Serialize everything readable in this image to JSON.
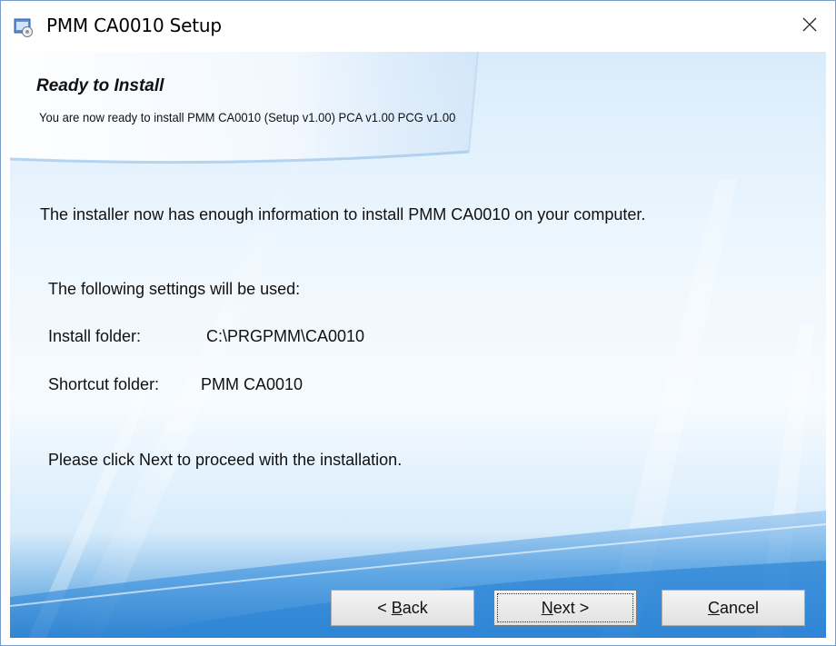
{
  "window": {
    "title": "PMM CA0010 Setup"
  },
  "header": {
    "title": "Ready to Install",
    "subtitle": "You are now ready to install PMM CA0010 (Setup v1.00) PCA v1.00 PCG v1.00"
  },
  "body": {
    "intro": "The installer now has enough information to install PMM CA0010 on your computer.",
    "settings_heading": "The following settings will be used:",
    "install_folder_label": "Install folder:",
    "install_folder_value": "C:\\PRGPMM\\CA0010",
    "shortcut_folder_label": "Shortcut folder:",
    "shortcut_folder_value": "PMM CA0010",
    "instruction": "Please click Next to proceed with the installation."
  },
  "buttons": {
    "back_prefix": "< ",
    "back_accel": "B",
    "back_rest": "ack",
    "next_accel": "N",
    "next_rest": "ext >",
    "cancel_accel": "C",
    "cancel_rest": "ancel"
  },
  "icons": {
    "app": "installer-app-icon",
    "close": "close-icon"
  },
  "colors": {
    "accent_blue": "#3f94da",
    "background_light": "#eef7fe"
  }
}
